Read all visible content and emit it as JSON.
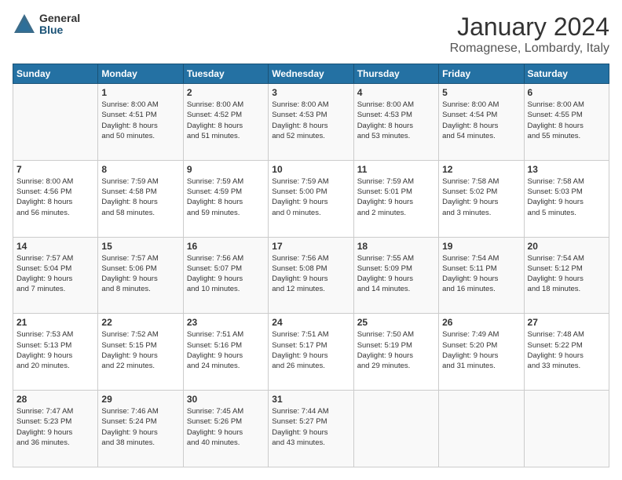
{
  "header": {
    "logo_general": "General",
    "logo_blue": "Blue",
    "title": "January 2024",
    "location": "Romagnese, Lombardy, Italy"
  },
  "days_of_week": [
    "Sunday",
    "Monday",
    "Tuesday",
    "Wednesday",
    "Thursday",
    "Friday",
    "Saturday"
  ],
  "weeks": [
    [
      {
        "day": "",
        "info": ""
      },
      {
        "day": "1",
        "info": "Sunrise: 8:00 AM\nSunset: 4:51 PM\nDaylight: 8 hours\nand 50 minutes."
      },
      {
        "day": "2",
        "info": "Sunrise: 8:00 AM\nSunset: 4:52 PM\nDaylight: 8 hours\nand 51 minutes."
      },
      {
        "day": "3",
        "info": "Sunrise: 8:00 AM\nSunset: 4:53 PM\nDaylight: 8 hours\nand 52 minutes."
      },
      {
        "day": "4",
        "info": "Sunrise: 8:00 AM\nSunset: 4:53 PM\nDaylight: 8 hours\nand 53 minutes."
      },
      {
        "day": "5",
        "info": "Sunrise: 8:00 AM\nSunset: 4:54 PM\nDaylight: 8 hours\nand 54 minutes."
      },
      {
        "day": "6",
        "info": "Sunrise: 8:00 AM\nSunset: 4:55 PM\nDaylight: 8 hours\nand 55 minutes."
      }
    ],
    [
      {
        "day": "7",
        "info": "Sunrise: 8:00 AM\nSunset: 4:56 PM\nDaylight: 8 hours\nand 56 minutes."
      },
      {
        "day": "8",
        "info": "Sunrise: 7:59 AM\nSunset: 4:58 PM\nDaylight: 8 hours\nand 58 minutes."
      },
      {
        "day": "9",
        "info": "Sunrise: 7:59 AM\nSunset: 4:59 PM\nDaylight: 8 hours\nand 59 minutes."
      },
      {
        "day": "10",
        "info": "Sunrise: 7:59 AM\nSunset: 5:00 PM\nDaylight: 9 hours\nand 0 minutes."
      },
      {
        "day": "11",
        "info": "Sunrise: 7:59 AM\nSunset: 5:01 PM\nDaylight: 9 hours\nand 2 minutes."
      },
      {
        "day": "12",
        "info": "Sunrise: 7:58 AM\nSunset: 5:02 PM\nDaylight: 9 hours\nand 3 minutes."
      },
      {
        "day": "13",
        "info": "Sunrise: 7:58 AM\nSunset: 5:03 PM\nDaylight: 9 hours\nand 5 minutes."
      }
    ],
    [
      {
        "day": "14",
        "info": "Sunrise: 7:57 AM\nSunset: 5:04 PM\nDaylight: 9 hours\nand 7 minutes."
      },
      {
        "day": "15",
        "info": "Sunrise: 7:57 AM\nSunset: 5:06 PM\nDaylight: 9 hours\nand 8 minutes."
      },
      {
        "day": "16",
        "info": "Sunrise: 7:56 AM\nSunset: 5:07 PM\nDaylight: 9 hours\nand 10 minutes."
      },
      {
        "day": "17",
        "info": "Sunrise: 7:56 AM\nSunset: 5:08 PM\nDaylight: 9 hours\nand 12 minutes."
      },
      {
        "day": "18",
        "info": "Sunrise: 7:55 AM\nSunset: 5:09 PM\nDaylight: 9 hours\nand 14 minutes."
      },
      {
        "day": "19",
        "info": "Sunrise: 7:54 AM\nSunset: 5:11 PM\nDaylight: 9 hours\nand 16 minutes."
      },
      {
        "day": "20",
        "info": "Sunrise: 7:54 AM\nSunset: 5:12 PM\nDaylight: 9 hours\nand 18 minutes."
      }
    ],
    [
      {
        "day": "21",
        "info": "Sunrise: 7:53 AM\nSunset: 5:13 PM\nDaylight: 9 hours\nand 20 minutes."
      },
      {
        "day": "22",
        "info": "Sunrise: 7:52 AM\nSunset: 5:15 PM\nDaylight: 9 hours\nand 22 minutes."
      },
      {
        "day": "23",
        "info": "Sunrise: 7:51 AM\nSunset: 5:16 PM\nDaylight: 9 hours\nand 24 minutes."
      },
      {
        "day": "24",
        "info": "Sunrise: 7:51 AM\nSunset: 5:17 PM\nDaylight: 9 hours\nand 26 minutes."
      },
      {
        "day": "25",
        "info": "Sunrise: 7:50 AM\nSunset: 5:19 PM\nDaylight: 9 hours\nand 29 minutes."
      },
      {
        "day": "26",
        "info": "Sunrise: 7:49 AM\nSunset: 5:20 PM\nDaylight: 9 hours\nand 31 minutes."
      },
      {
        "day": "27",
        "info": "Sunrise: 7:48 AM\nSunset: 5:22 PM\nDaylight: 9 hours\nand 33 minutes."
      }
    ],
    [
      {
        "day": "28",
        "info": "Sunrise: 7:47 AM\nSunset: 5:23 PM\nDaylight: 9 hours\nand 36 minutes."
      },
      {
        "day": "29",
        "info": "Sunrise: 7:46 AM\nSunset: 5:24 PM\nDaylight: 9 hours\nand 38 minutes."
      },
      {
        "day": "30",
        "info": "Sunrise: 7:45 AM\nSunset: 5:26 PM\nDaylight: 9 hours\nand 40 minutes."
      },
      {
        "day": "31",
        "info": "Sunrise: 7:44 AM\nSunset: 5:27 PM\nDaylight: 9 hours\nand 43 minutes."
      },
      {
        "day": "",
        "info": ""
      },
      {
        "day": "",
        "info": ""
      },
      {
        "day": "",
        "info": ""
      }
    ]
  ]
}
